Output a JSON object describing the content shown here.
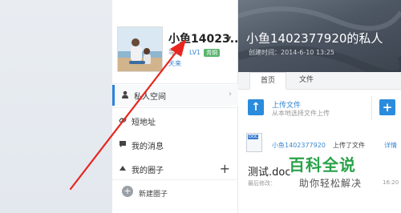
{
  "profile": {
    "username": "小鱼14023...",
    "level_prefix": "等级：",
    "level": "LV1",
    "badge": "青铜",
    "sub_link": "天来"
  },
  "sidebar": {
    "items": [
      {
        "label": "私人空间",
        "icon": "person-icon"
      },
      {
        "label": "短地址",
        "icon": "link-icon"
      },
      {
        "label": "我的消息",
        "icon": "message-icon"
      },
      {
        "label": "我的圈子",
        "icon": "triangle-icon"
      }
    ],
    "new_circle": "新建圈子"
  },
  "banner": {
    "title": "小鱼1402377920的私人",
    "created": "创建时间：2014-6-10 13:25"
  },
  "tabs": [
    {
      "label": "首页",
      "active": true
    },
    {
      "label": "文件",
      "active": false
    }
  ],
  "upload": {
    "title": "上传文件",
    "subtitle": "从本地选择文件上传"
  },
  "feed": {
    "doc_badge": "DOC",
    "user": "小鱼1402377920",
    "text": "上传了文件",
    "more": "详情",
    "file_title": "测试.doc",
    "meta": "最后修改：",
    "time": "16:20"
  },
  "watermark": {
    "title": "百科全说",
    "subtitle": "助你轻松解决"
  },
  "colors": {
    "accent": "#2b82d9",
    "arrow": "#e8261f",
    "watermark": "#2aa24a"
  }
}
